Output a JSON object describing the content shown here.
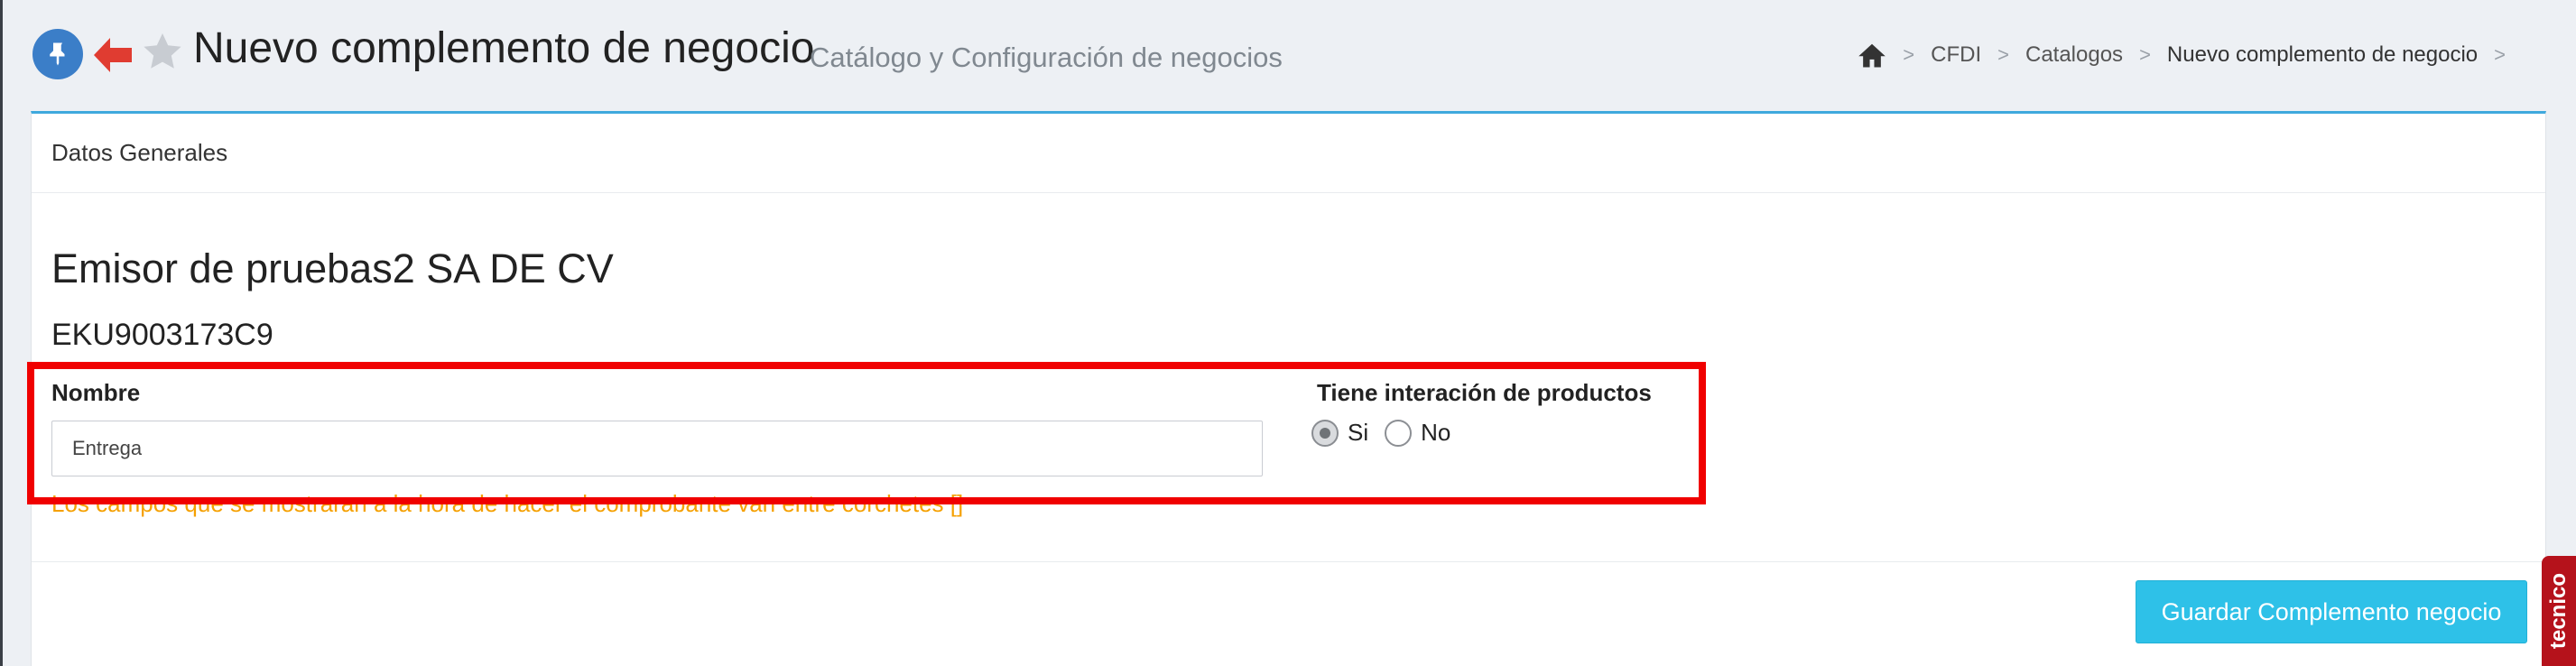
{
  "header": {
    "title": "Nuevo complemento de negocio",
    "subtitle": "Catálogo y Configuración de negocios"
  },
  "breadcrumb": {
    "items": [
      "CFDI",
      "Catalogos",
      "Nuevo complemento de negocio"
    ],
    "separator": ">"
  },
  "panel": {
    "heading": "Datos Generales",
    "company_name": "Emisor de pruebas2 SA DE CV",
    "rfc": "EKU9003173C9"
  },
  "form": {
    "nombre_label": "Nombre",
    "nombre_value": "Entrega",
    "interaction_label": "Tiene interación de productos",
    "option_yes": "Si",
    "option_no": "No",
    "selected": "Si",
    "warning": "Los campos que se mostraran a la hora de hacer el comprobante van entre corchetes []"
  },
  "actions": {
    "save_label": "Guardar Complemento negocio"
  },
  "side_tab": {
    "label": "tecnico"
  },
  "colors": {
    "accent": "#3fa9dd",
    "button": "#2ec1e8",
    "back_arrow": "#e03c31",
    "pin": "#3b7ec8",
    "warning": "#f5a000",
    "highlight": "#f00000",
    "side_tab": "#b5121b"
  },
  "icons": [
    "pin-icon",
    "back-arrow-icon",
    "star-icon",
    "home-icon"
  ]
}
